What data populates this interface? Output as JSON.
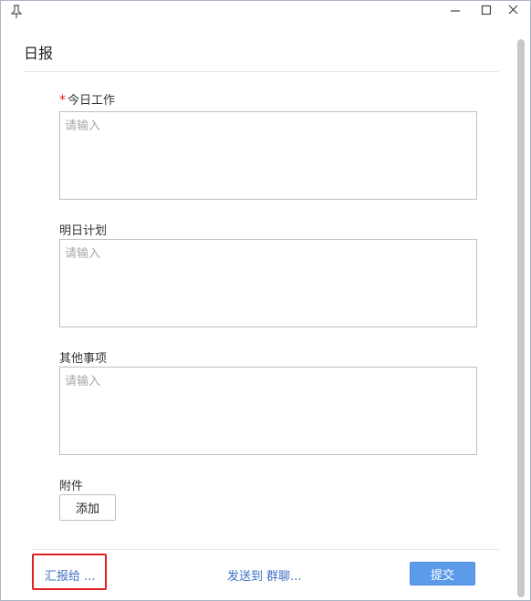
{
  "window": {
    "title": "日报"
  },
  "fields": {
    "today_work": {
      "label": "今日工作",
      "required_mark": "*",
      "placeholder": "请输入",
      "value": ""
    },
    "tomorrow_plan": {
      "label": "明日计划",
      "placeholder": "请输入",
      "value": ""
    },
    "other_matters": {
      "label": "其他事项",
      "placeholder": "请输入",
      "value": ""
    },
    "attachment": {
      "label": "附件",
      "add_label": "添加"
    }
  },
  "footer": {
    "report_to_label": "汇报给 ...",
    "send_to_label": "发送到 群聊...",
    "submit_label": "提交"
  },
  "colors": {
    "link": "#3e6fc4",
    "required": "#e02020",
    "submit_bg": "#5b9bea",
    "highlight_border": "#e02020"
  }
}
